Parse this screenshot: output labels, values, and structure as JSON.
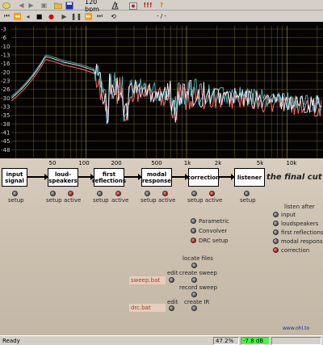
{
  "toolbar": {
    "tempo": "120 bpm",
    "position": "- / -",
    "alert": "!!!",
    "help": "?"
  },
  "chart_data": {
    "type": "line",
    "y_ticks": [
      "-3",
      "-6",
      "-10",
      "-13",
      "-16",
      "-20",
      "-23",
      "-26",
      "-30",
      "-33",
      "-35",
      "-38",
      "-41",
      "-45",
      "-48"
    ],
    "x_ticks": [
      "50",
      "100",
      "200",
      "500",
      "1k",
      "2k",
      "5k",
      "10k"
    ],
    "colors": {
      "grid": "#d8cf86",
      "series_a": "#f0f0ff",
      "series_b": "#ff6a60",
      "series_c": "#4ab8c0",
      "background": "#060400"
    }
  },
  "chain": {
    "stages": [
      {
        "label": "input\nsignal"
      },
      {
        "label": "loud-\nspeakers"
      },
      {
        "label": "first\nreflections"
      },
      {
        "label": "modal\nresponse"
      },
      {
        "label": "correction"
      },
      {
        "label": "listener"
      }
    ],
    "title": "the final cut",
    "setup_label": "setup",
    "active_label": "active"
  },
  "correction_menu": {
    "items": [
      "Parametric",
      "Convolver",
      "DRC setup"
    ]
  },
  "listen_after": {
    "title": "listen after",
    "items": [
      "input",
      "loudspeakers",
      "first reflections",
      "modal response",
      "correction"
    ]
  },
  "files": {
    "locate": "locate files",
    "sweep_bat": "sweep.bat",
    "edit": "edit",
    "create_sweep": "create sweep",
    "record_sweep": "record sweep",
    "drc_bat": "drc.bat",
    "create_ir": "create IR",
    "website": "www.ohl.to"
  },
  "status": {
    "ready": "Ready",
    "percent": "47.2%",
    "db": "-7.8 dB"
  }
}
